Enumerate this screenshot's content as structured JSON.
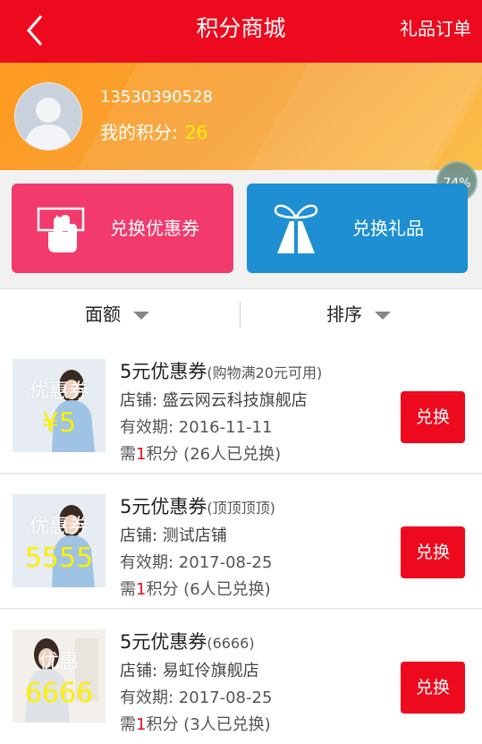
{
  "header": {
    "title": "积分商城",
    "right_link": "礼品订单",
    "back_icon": "chevron-left-icon"
  },
  "user": {
    "phone": "13530390528",
    "points_label": "我的积分:",
    "points_value": "26"
  },
  "overlay": {
    "percent": "74%"
  },
  "actions": {
    "coupon_label": "兑换优惠券",
    "gift_label": "兑换礼品",
    "coupon_color": "#f23a6d",
    "gift_color": "#1e8fd2"
  },
  "filters": [
    {
      "label": "面额"
    },
    {
      "label": "排序"
    }
  ],
  "items": [
    {
      "name": "5元优惠券",
      "condition": "(购物满20元可用)",
      "store": "店铺: 盛云网云科技旗舰店",
      "validity": "有效期: 2016-11-11",
      "need_prefix": "需",
      "need_num": "1",
      "need_suffix": "积分 (26人已兑换)",
      "thumb_text1": "优惠券",
      "thumb_text2": "¥5",
      "button": "兑换"
    },
    {
      "name": "5元优惠券",
      "condition": "(顶顶顶顶)",
      "store": "店铺: 测试店铺",
      "validity": "有效期: 2017-08-25",
      "need_prefix": "需",
      "need_num": "1",
      "need_suffix": "积分 (6人已兑换)",
      "thumb_text1": "优惠券",
      "thumb_text2": "5555",
      "button": "兑换"
    },
    {
      "name": "5元优惠券",
      "condition": "(6666)",
      "store": "店铺: 易虹伶旗舰店",
      "validity": "有效期: 2017-08-25",
      "need_prefix": "需",
      "need_num": "1",
      "need_suffix": "积分 (3人已兑换)",
      "thumb_text1": "优惠",
      "thumb_text2": "6666",
      "button": "兑换"
    }
  ],
  "colors": {
    "header_red": "#ee0a1e",
    "points_yellow": "#fff200"
  }
}
